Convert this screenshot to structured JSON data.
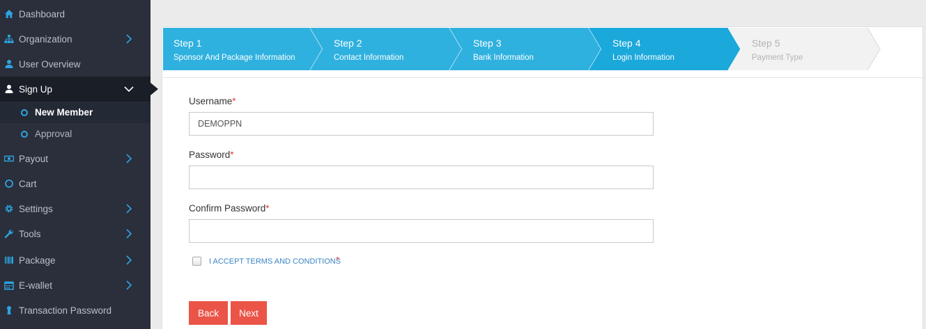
{
  "sidebar": {
    "items": [
      {
        "label": "Dashboard",
        "icon": "home-icon"
      },
      {
        "label": "Organization",
        "icon": "sitemap-icon"
      },
      {
        "label": "User Overview",
        "icon": "user-icon"
      },
      {
        "label": "Sign Up",
        "icon": "user-icon"
      },
      {
        "label": "Payout",
        "icon": "money-icon"
      },
      {
        "label": "Cart",
        "icon": "circle-icon"
      },
      {
        "label": "Settings",
        "icon": "gear-icon"
      },
      {
        "label": "Tools",
        "icon": "wrench-icon"
      },
      {
        "label": "Package",
        "icon": "barcode-icon"
      },
      {
        "label": "E-wallet",
        "icon": "calendar-icon"
      },
      {
        "label": "Transaction Password",
        "icon": "keyhole-icon"
      }
    ],
    "signup_sub": [
      {
        "label": "New Member"
      },
      {
        "label": "Approval"
      }
    ]
  },
  "wizard": {
    "steps": [
      {
        "num": "Step 1",
        "label": "Sponsor And Package Information",
        "state": "done"
      },
      {
        "num": "Step 2",
        "label": "Contact Information",
        "state": "done"
      },
      {
        "num": "Step 3",
        "label": "Bank Information",
        "state": "done"
      },
      {
        "num": "Step 4",
        "label": "Login Information",
        "state": "current"
      },
      {
        "num": "Step 5",
        "label": "Payment Type",
        "state": "disabled"
      }
    ]
  },
  "form": {
    "username_label": "Username",
    "username_value": "DEMOPPN",
    "password_label": "Password",
    "password_value": "",
    "confirm_label": "Confirm Password",
    "confirm_value": "",
    "required_mark": "*",
    "terms_label": "I ACCEPT TERMS AND CONDITIONS",
    "terms_checked": false,
    "back_label": "Back",
    "next_label": "Next"
  },
  "colors": {
    "sidebar_bg": "#2a2f3b",
    "step_done": "#2fb1df",
    "step_current": "#1ba8db",
    "step_disabled": "#f2f2f2",
    "button": "#ea5547",
    "accent": "#2ea4e0"
  }
}
